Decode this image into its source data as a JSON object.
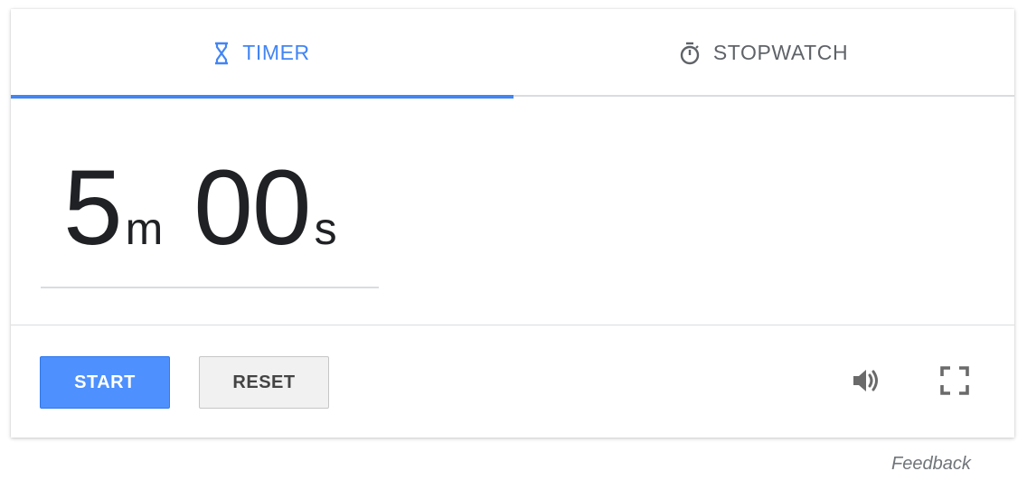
{
  "tabs": {
    "timer": {
      "label": "TIMER",
      "icon": "hourglass-icon",
      "active": true
    },
    "stopwatch": {
      "label": "STOPWATCH",
      "icon": "stopwatch-icon",
      "active": false
    }
  },
  "timer_display": {
    "minutes": "5",
    "minutes_unit": "m",
    "seconds": "00",
    "seconds_unit": "s"
  },
  "controls": {
    "start_label": "START",
    "reset_label": "RESET",
    "volume_icon": "volume-icon",
    "fullscreen_icon": "fullscreen-icon"
  },
  "feedback_label": "Feedback",
  "colors": {
    "accent": "#4285f4",
    "start_button": "#4d90fe",
    "reset_button": "#f1f1f1",
    "text_dark": "#202124",
    "text_muted": "#5f6368"
  }
}
